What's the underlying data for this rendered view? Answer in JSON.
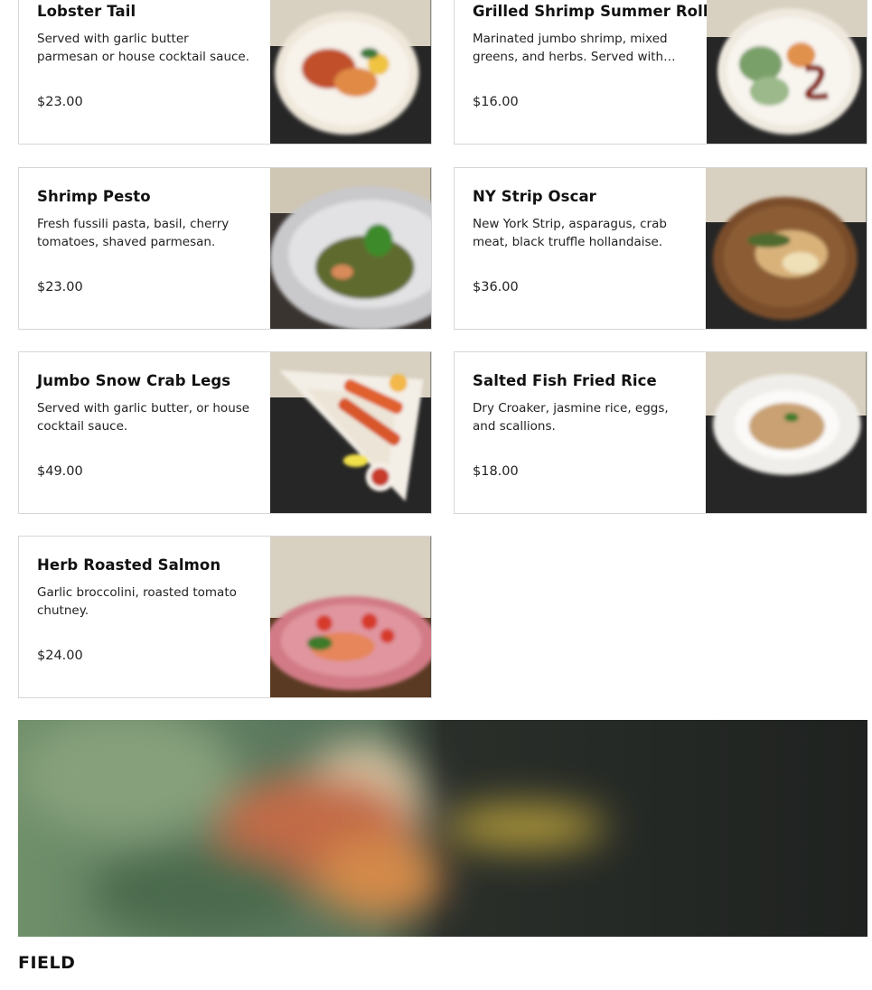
{
  "menu": {
    "items": [
      {
        "name": "Lobster Tail",
        "description": "Served with garlic butter parmesan or house cocktail sauce.",
        "price": "$23.00"
      },
      {
        "name": "Grilled Shrimp Summer Roll",
        "description": "Marinated jumbo shrimp, mixed greens, and herbs. Served with sauce.",
        "price": "$16.00"
      },
      {
        "name": "Shrimp Pesto",
        "description": "Fresh fussili pasta, basil, cherry tomatoes, shaved parmesan.",
        "price": "$23.00"
      },
      {
        "name": "NY Strip Oscar",
        "description": "New York Strip, asparagus, crab meat, black truffle hollandaise.",
        "price": "$36.00"
      },
      {
        "name": "Jumbo Snow Crab Legs",
        "description": "Served with garlic butter, or house cocktail sauce.",
        "price": "$49.00"
      },
      {
        "name": "Salted Fish Fried Rice",
        "description": "Dry Croaker, jasmine rice, eggs, and scallions.",
        "price": "$18.00"
      },
      {
        "name": "Herb Roasted Salmon",
        "description": "Garlic broccolini, roasted tomato chutney.",
        "price": "$24.00"
      }
    ]
  },
  "section": {
    "title": "FIELD"
  },
  "colors": {
    "border": "#d6d6d6",
    "table_dark": "#2a2a2a",
    "wall": "#d9d2c4",
    "banner_green": "#6f8f6a"
  }
}
